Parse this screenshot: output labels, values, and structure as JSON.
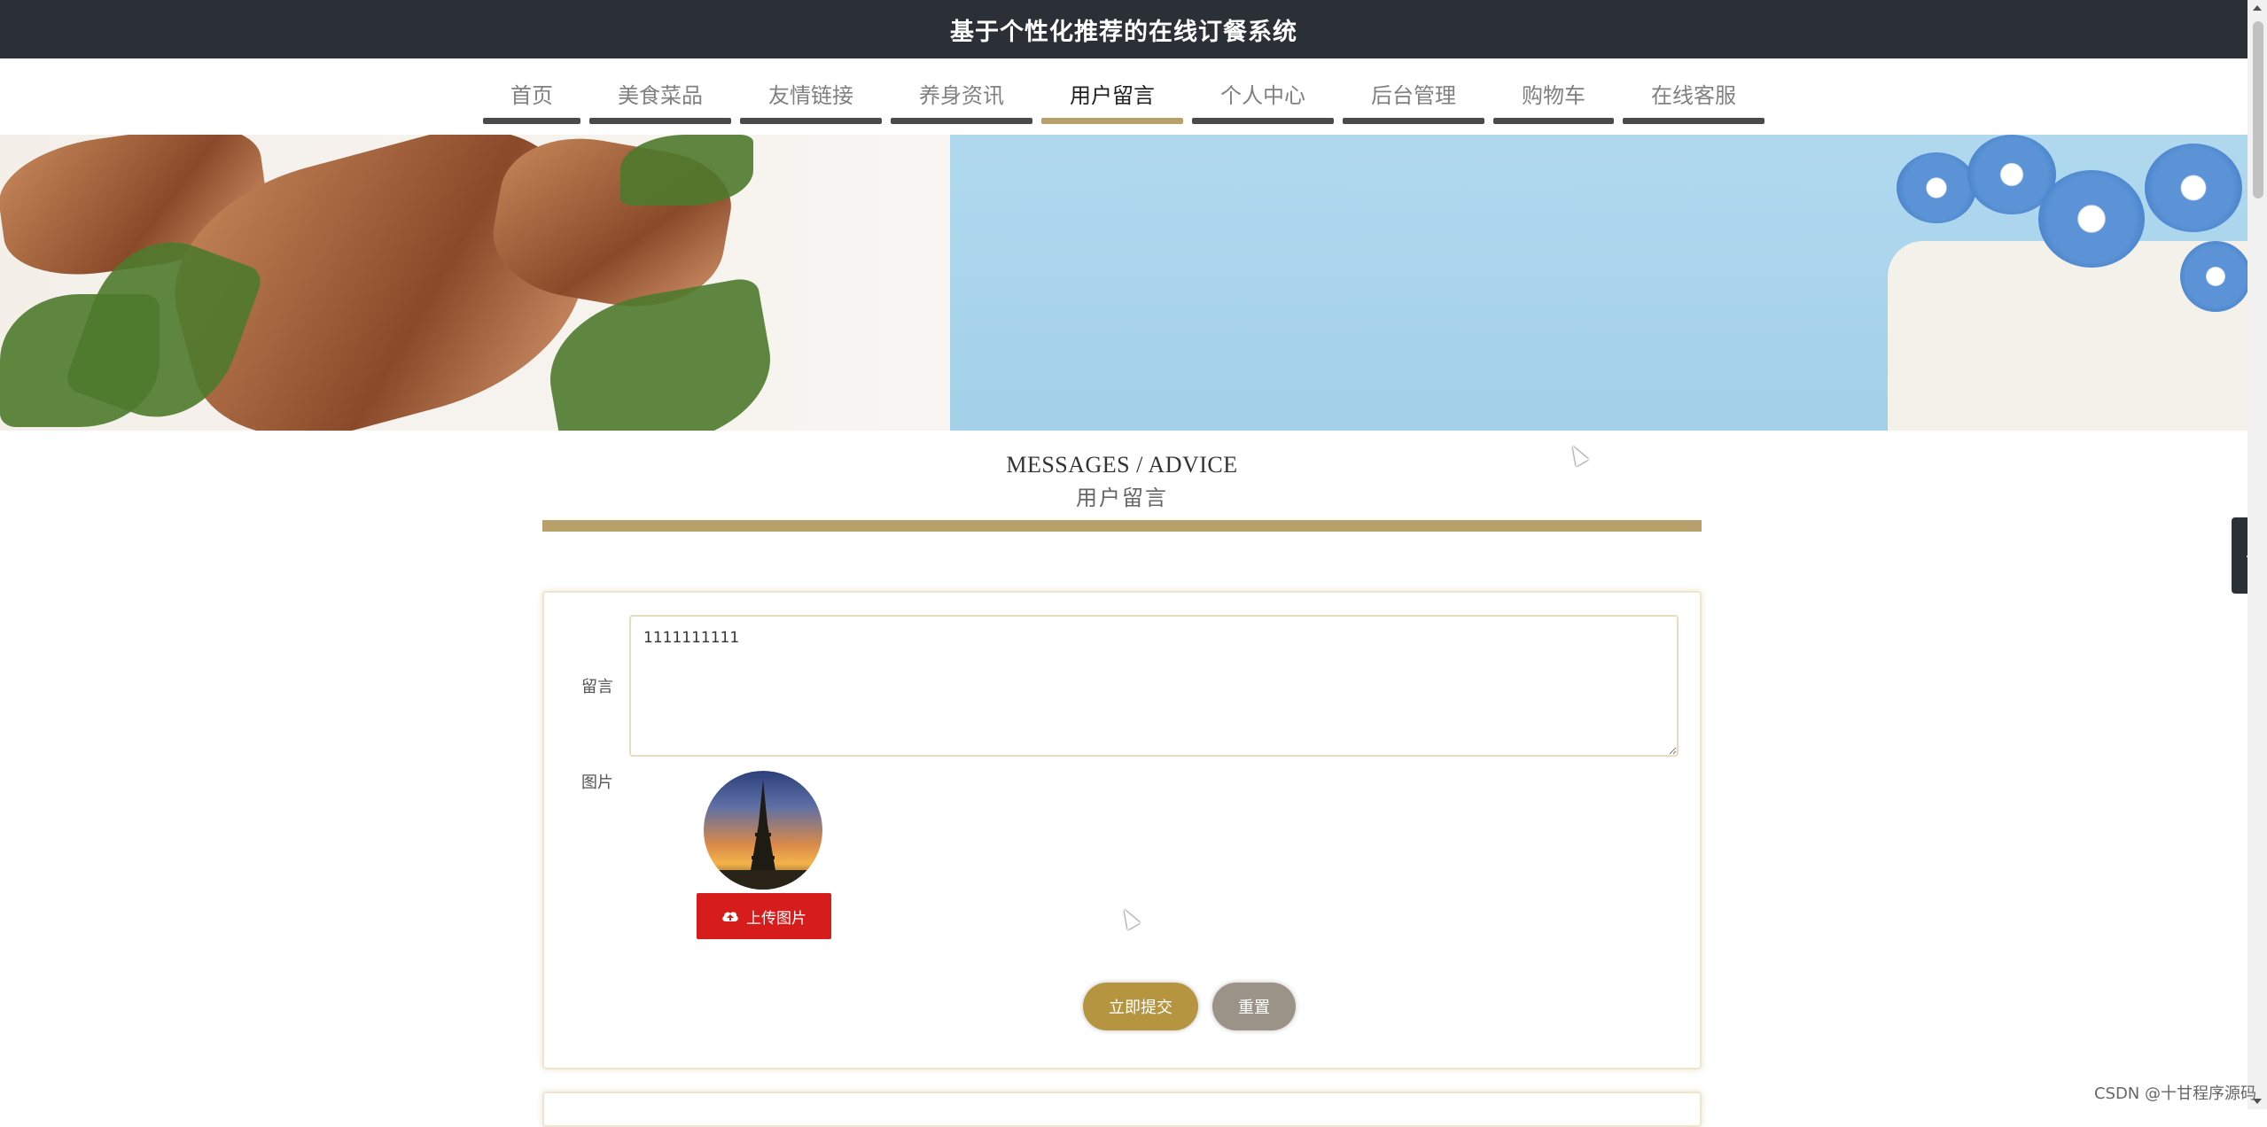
{
  "header": {
    "title": "基于个性化推荐的在线订餐系统"
  },
  "nav": {
    "items": [
      {
        "label": "首页",
        "active": false
      },
      {
        "label": "美食菜品",
        "active": false
      },
      {
        "label": "友情链接",
        "active": false
      },
      {
        "label": "养身资讯",
        "active": false
      },
      {
        "label": "用户留言",
        "active": true
      },
      {
        "label": "个人中心",
        "active": false
      },
      {
        "label": "后台管理",
        "active": false
      },
      {
        "label": "购物车",
        "active": false
      },
      {
        "label": "在线客服",
        "active": false
      }
    ]
  },
  "section": {
    "title_en": "MESSAGES / ADVICE",
    "title_cn": "用户留言"
  },
  "form": {
    "message_label": "留言",
    "message_value": "1111111111",
    "image_label": "图片",
    "upload_label": "上传图片",
    "submit_label": "立即提交",
    "reset_label": "重置"
  },
  "side_tab": {
    "icon": "chevron-left-icon",
    "glyph": "‹"
  },
  "watermark": "CSDN @十甘程序源码",
  "colors": {
    "accent": "#b8a06a",
    "topbar": "#2b2f36",
    "upload": "#d71c1c",
    "submit": "#b5953f",
    "reset": "#9b9387"
  }
}
